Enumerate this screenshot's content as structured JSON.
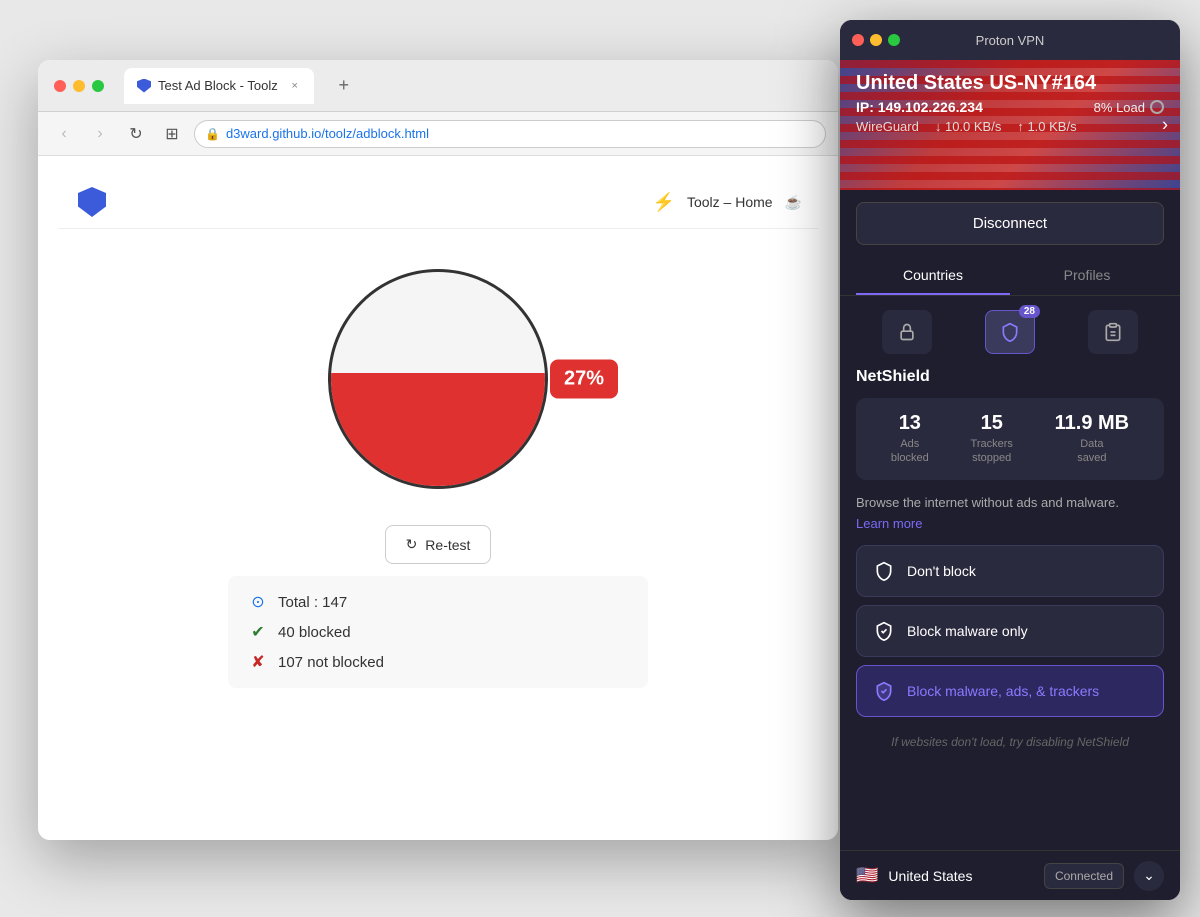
{
  "browser": {
    "tab_title": "Test Ad Block - Toolz",
    "new_tab_label": "+",
    "nav_back": "‹",
    "nav_forward": "›",
    "nav_reload": "↻",
    "nav_grid": "⊞",
    "address_url": "d3ward.github.io/toolz/adblock.html",
    "topbar_home": "Toolz – Home",
    "retest_label": "Re-test",
    "gauge_percent": "27%",
    "stats": {
      "total_label": "Total : 147",
      "blocked_label": "40 blocked",
      "not_blocked_label": "107 not blocked"
    }
  },
  "vpn": {
    "app_title": "Proton VPN",
    "country_server": "United States US-NY#164",
    "ip_label": "IP: 149.102.226.234",
    "load_label": "8% Load",
    "protocol": "WireGuard",
    "speed_down": "↓ 10.0 KB/s",
    "speed_up": "↑ 1.0 KB/s",
    "disconnect_label": "Disconnect",
    "tab_countries": "Countries",
    "tab_profiles": "Profiles",
    "badge_count": "28",
    "netshield_title": "NetShield",
    "ns_ads": "13",
    "ns_ads_label": "Ads\nblocked",
    "ns_trackers": "15",
    "ns_trackers_label": "Trackers\nstopped",
    "ns_data": "11.9 MB",
    "ns_data_label": "Data\nsaved",
    "ns_desc": "Browse the internet without ads and malware.",
    "ns_learn": "Learn more",
    "option1_label": "Don't block",
    "option2_label": "Block malware only",
    "option3_label": "Block malware, ads, & trackers",
    "ns_footer": "If websites don't load, try disabling NetShield",
    "bottom_country": "United States",
    "bottom_connected": "Connected"
  }
}
